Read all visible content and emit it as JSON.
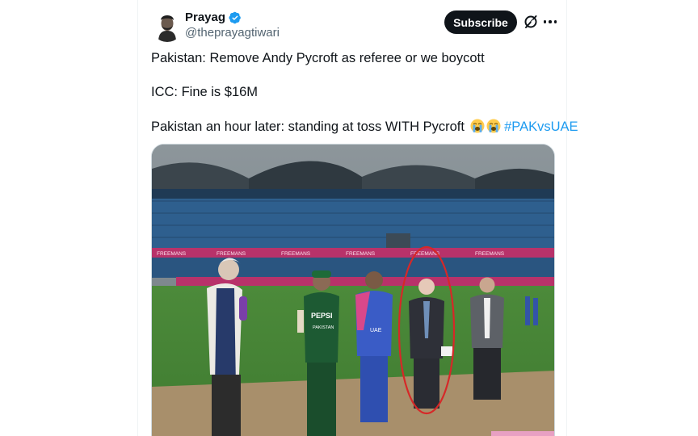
{
  "author": {
    "name": "Prayag",
    "handle": "@theprayagtiwari",
    "verified": true
  },
  "actions": {
    "subscribe_label": "Subscribe",
    "grok_icon": "grok-icon",
    "more_icon": "more-options-icon"
  },
  "tweet": {
    "line1": "Pakistan: Remove Andy Pycroft as referee or we boycott",
    "line2": "ICC: Fine is $16M",
    "line3_text": "Pakistan an hour later: standing at toss WITH Pycroft ",
    "line3_emojis": [
      "loudly-crying-face",
      "loudly-crying-face"
    ],
    "hashtag": "#PAKvsUAE"
  },
  "media": {
    "type": "photo",
    "description_icon": "cricket-stadium-photo",
    "board_text": "FREEMANS",
    "shirt_texts": [
      "PEPSI",
      "PAKISTAN",
      "UAE"
    ]
  },
  "colors": {
    "link": "#1d9bf0",
    "text": "#0f1419",
    "secondary": "#536471",
    "button_bg": "#0f1419",
    "verified": "#1d9bf0",
    "circle": "#d62828"
  }
}
